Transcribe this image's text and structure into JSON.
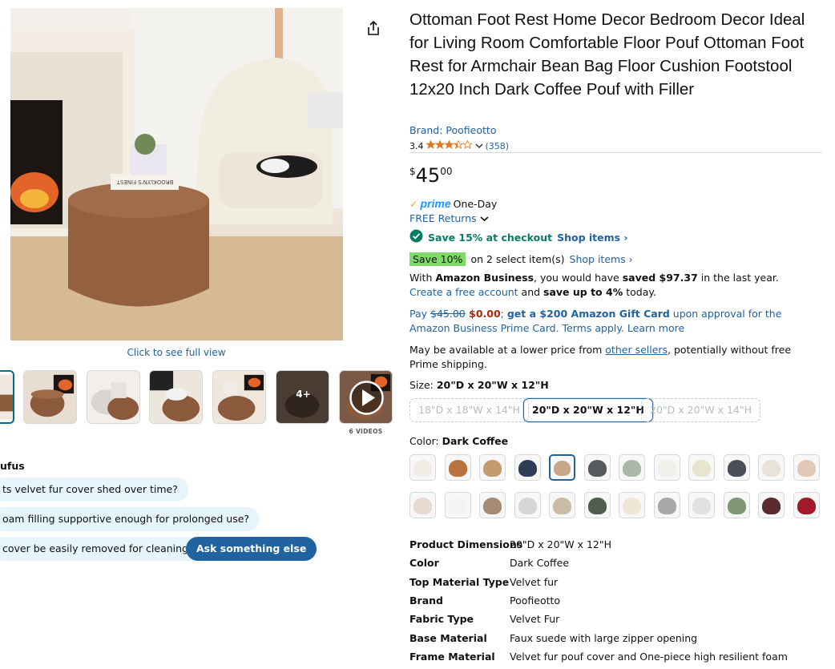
{
  "left": {
    "full_view_link": "Click to see full view",
    "thumbnails_extra_label": "4+",
    "videos_label": "6 VIDEOS",
    "main_image_text": "BROOKLYN'S FINEST"
  },
  "rufus": {
    "title": "Rufus",
    "title_visible": "ufus",
    "questions": [
      "ts velvet fur cover shed over time?",
      "oam filling supportive enough for prolonged use?",
      " cover be easily removed for cleaning?"
    ],
    "ask_label": "Ask something else"
  },
  "product": {
    "title": "Ottoman Foot Rest Home Decor Bedroom Decor Ideal for Living Room Comfortable Floor Pouf Ottoman Foot Rest for Armchair Bean Bag Floor Cushion Footstool 12x20 Inch Dark Coffee Pouf with Filler",
    "brand_link": "Brand: Poofieotto",
    "rating": "3.4",
    "rating_stars": 3.4,
    "review_count": "(358)",
    "price_symbol": "$",
    "price_whole": "45",
    "price_fraction": "00"
  },
  "delivery": {
    "prime_check": "✓",
    "prime_word": "prime",
    "prime_speed": "One-Day",
    "free_returns": "FREE Returns",
    "checkout_offer": "Save 15% at checkout",
    "shop_items_1": "Shop items ›",
    "save10_badge": "Save 10%",
    "save10_text": "on 2 select item(s)",
    "shop_items_2": "Shop items ›"
  },
  "business": {
    "p1": "With ",
    "p2": "Amazon Business",
    "p3": ", you would have ",
    "p4": "saved $97.37",
    "p5": " in the last year. ",
    "link": "Create a free account",
    "p6": " and ",
    "p7": "save up to 4%",
    "p8": " today."
  },
  "card": {
    "pay": "Pay ",
    "old_price": "$45.00",
    "new_price": " $0.00",
    "semi": "; ",
    "gift": "get a $200 Amazon Gift Card",
    "rest": " upon approval for the Amazon Business Prime Card. Terms apply. Learn more"
  },
  "lower_price": {
    "p1": "May be available at a lower price from ",
    "link": "other sellers",
    "p2": ", potentially without free Prime shipping."
  },
  "size": {
    "label": "Size: ",
    "selected": "20\"D x 20\"W x 12\"H",
    "options": [
      "18\"D x 18\"W x 14\"H",
      "20\"D x 20\"W x 12\"H",
      "20\"D x 20\"W x 14\"H"
    ]
  },
  "color": {
    "label": "Color: ",
    "selected": "Dark Coffee",
    "swatch_colors_row1": [
      "#f2ece6",
      "#b9733f",
      "#c49a6f",
      "#2f3d56",
      "#c8a68a",
      "#555a5e",
      "#a9b8a7",
      "#f1efe9",
      "#e7e5cf",
      "#4b4f59",
      "#e9e2d8",
      "#e2c8b7"
    ],
    "swatch_colors_row2": [
      "#e9d9cf",
      "#f4f4f4",
      "#a58a74",
      "#d6d6d6",
      "#cbbca8",
      "#4f5c4e",
      "#efe6d6",
      "#a7a8aa",
      "#dfe1e3",
      "#7f9677",
      "#5a2a2c",
      "#a21a2a"
    ]
  },
  "specs": [
    {
      "label": "Product Dimensions",
      "value": "20\"D x 20\"W x 12\"H"
    },
    {
      "label": "Color",
      "value": "Dark Coffee"
    },
    {
      "label": "Top Material Type",
      "value": "Velvet fur"
    },
    {
      "label": "Brand",
      "value": "Poofieotto"
    },
    {
      "label": "Fabric Type",
      "value": "Velvet Fur"
    },
    {
      "label": "Base Material",
      "value": "Faux suede with large zipper opening"
    },
    {
      "label": "Frame Material",
      "value": "Velvet fur pouf cover and One-piece high resilient foam"
    }
  ],
  "colors": {
    "link": "#2162a1",
    "prime_blue": "#1a98ff",
    "deal_green": "#067d62",
    "save_badge": "#7fda69",
    "price_red": "#b12704",
    "chip_bg": "#e6f4fb",
    "ask_bg": "#2162a1"
  },
  "icons": {
    "share": "share-icon",
    "check": "green-check-icon",
    "chevron": "chevron-down-icon",
    "play": "play-icon",
    "star": "star-icon"
  }
}
